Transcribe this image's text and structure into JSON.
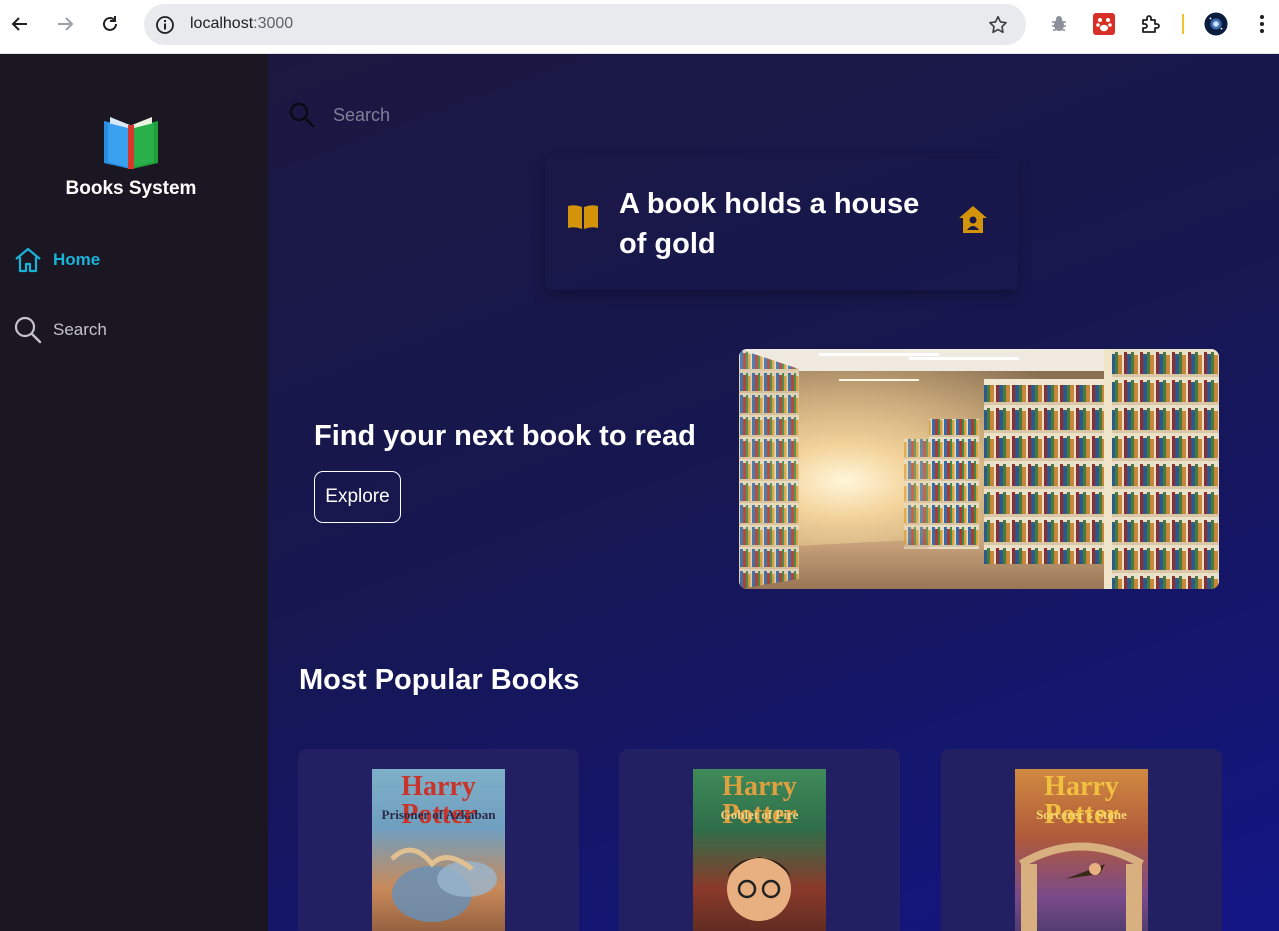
{
  "browser": {
    "url_host": "localhost",
    "url_port": ":3000"
  },
  "sidebar": {
    "brand": "Books System",
    "items": [
      {
        "label": "Home",
        "icon": "home-icon",
        "active": true
      },
      {
        "label": "Search",
        "icon": "search-icon",
        "active": false
      }
    ]
  },
  "main": {
    "search_placeholder": "Search",
    "quote": "A book holds a house of gold",
    "hero_title": "Find your next book to read",
    "explore_label": "Explore",
    "section_title": "Most Popular Books",
    "books": [
      {
        "title": "Harry Potter",
        "subtitle": "Prisoner of Azkaban"
      },
      {
        "title": "Harry Potter",
        "subtitle": "Goblet of Fire"
      },
      {
        "title": "Harry Potter",
        "subtitle": "Sorcerer's Stone"
      }
    ]
  },
  "colors": {
    "sidebar_bg": "#1a1723",
    "accent": "#19b3d8",
    "quote_icon": "#d4940a",
    "card_bg": "#231f63"
  }
}
